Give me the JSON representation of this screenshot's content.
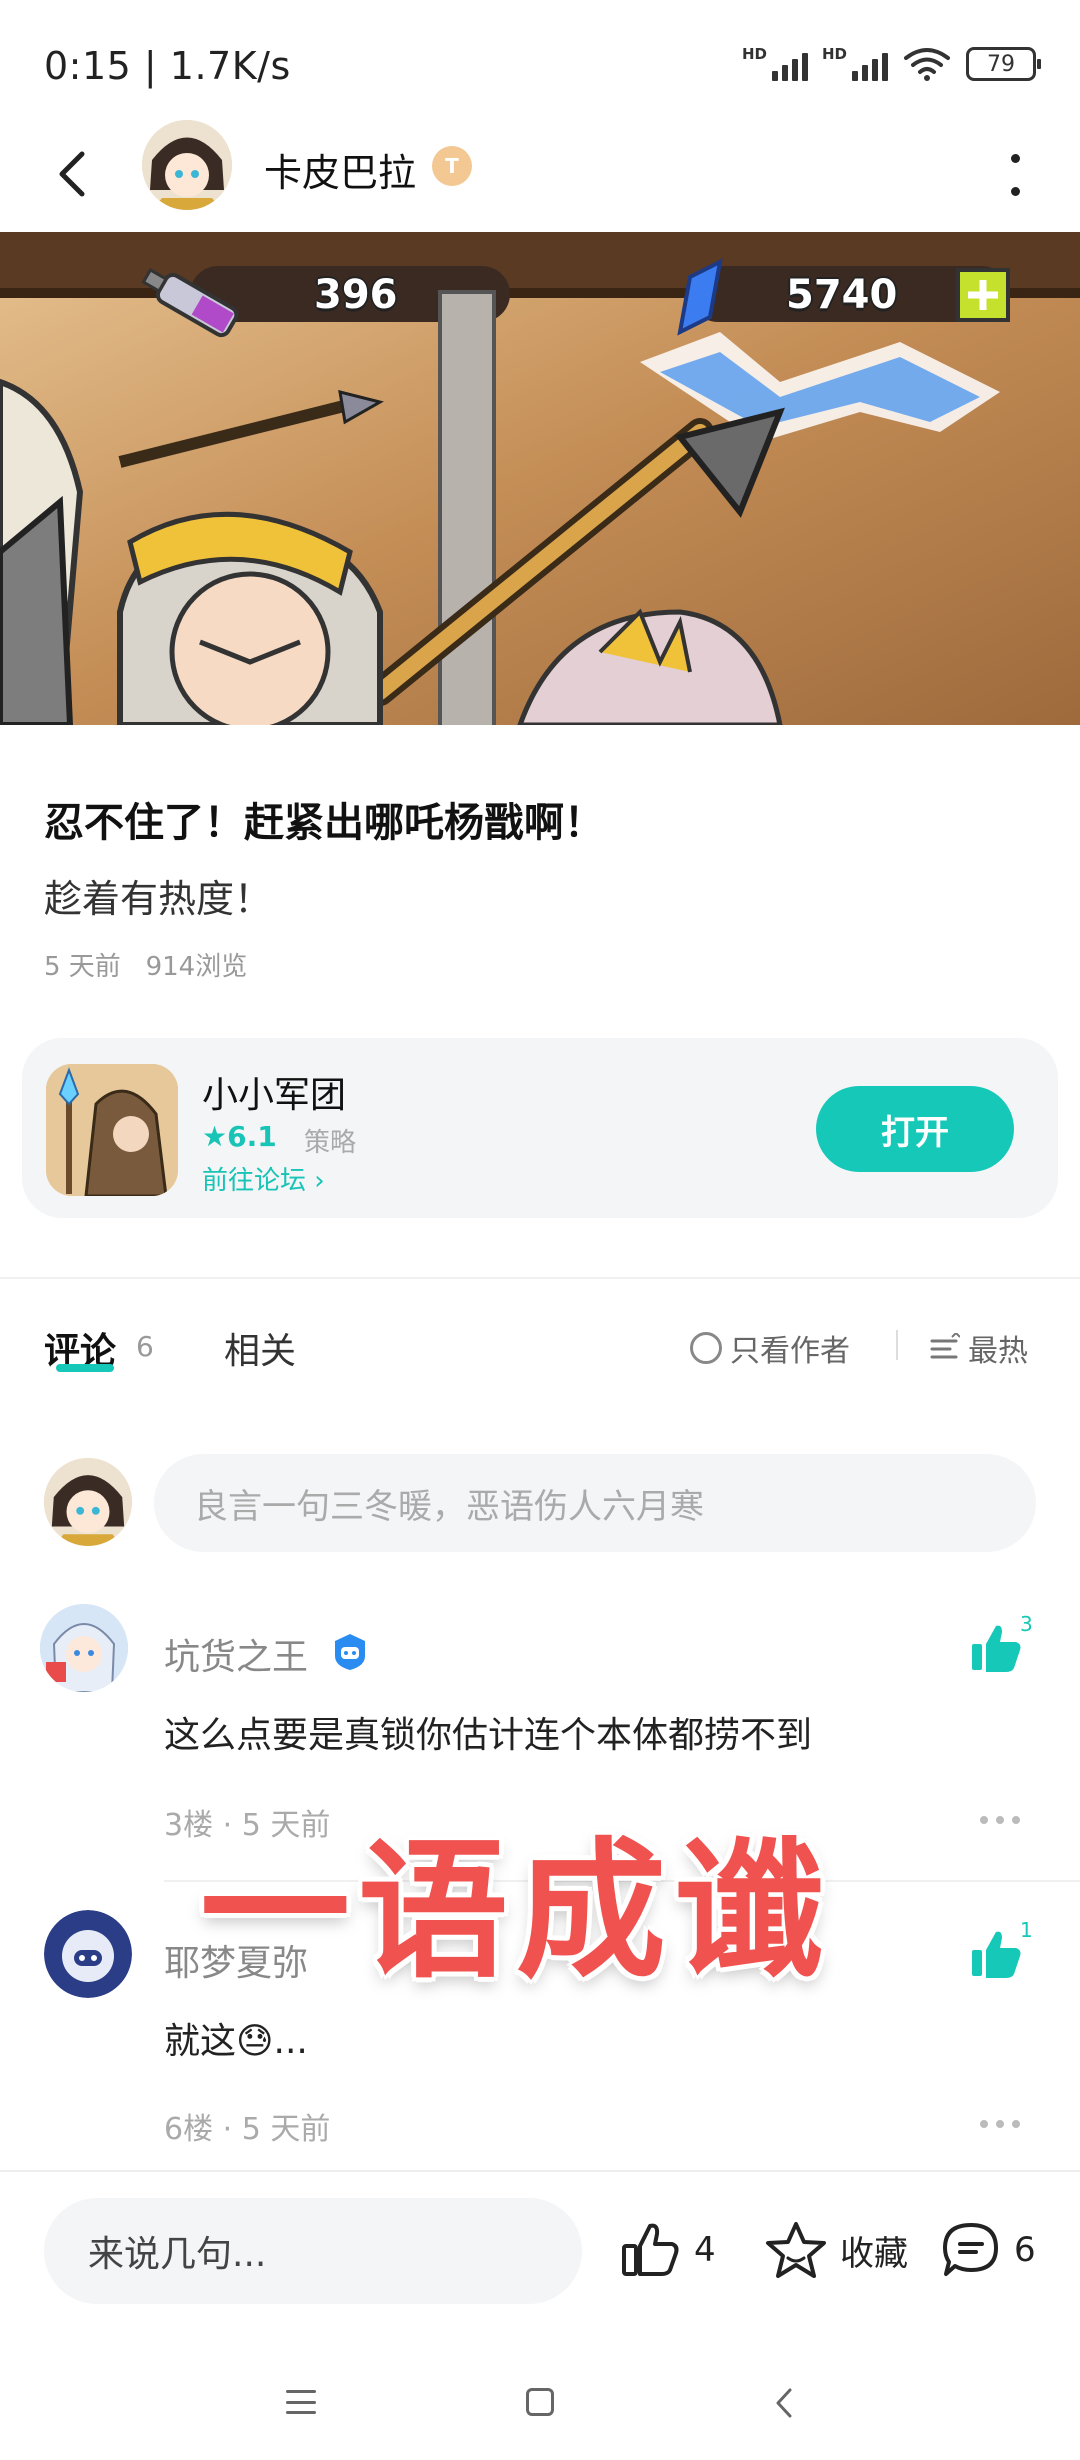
{
  "status_bar": {
    "time": "0:15 | 1.7K/s",
    "signal_1_label": "HD",
    "signal_2_label": "HD",
    "battery": "79"
  },
  "header": {
    "author_name": "卡皮巴拉",
    "author_badge": "T"
  },
  "hero": {
    "resource_1": "396",
    "resource_2": "5740"
  },
  "post": {
    "title": "忍不住了！赶紧出哪吒杨戬啊！",
    "body": "趁着有热度！",
    "meta": "5 天前   914浏览"
  },
  "app_card": {
    "name": "小小军团",
    "rating": "6.1",
    "genre": "策略",
    "forum_link": "前往论坛 ",
    "open_label": "打开"
  },
  "tabs": {
    "comments_label": "评论",
    "comments_count": "6",
    "related_label": "相关",
    "author_only_label": "只看作者",
    "sort_label": "最热"
  },
  "comment_input": {
    "placeholder": "良言一句三冬暖，恶语伤人六月寒"
  },
  "comments": [
    {
      "user": "坑货之王",
      "text": "这么点要是真锁你估计连个本体都捞不到",
      "meta": "3楼 · 5 天前",
      "likes": "3"
    },
    {
      "user": "耶梦夏弥",
      "text": "就这😓...",
      "meta": "6楼 · 5 天前",
      "likes": "1"
    }
  ],
  "overlay_caption": "一语成谶",
  "bottom_bar": {
    "reply_placeholder": "来说几句...",
    "like_count": "4",
    "favorite_label": "收藏",
    "comment_count": "6"
  },
  "colors": {
    "accent": "#15c8b8",
    "caption_red": "#f0524f"
  }
}
